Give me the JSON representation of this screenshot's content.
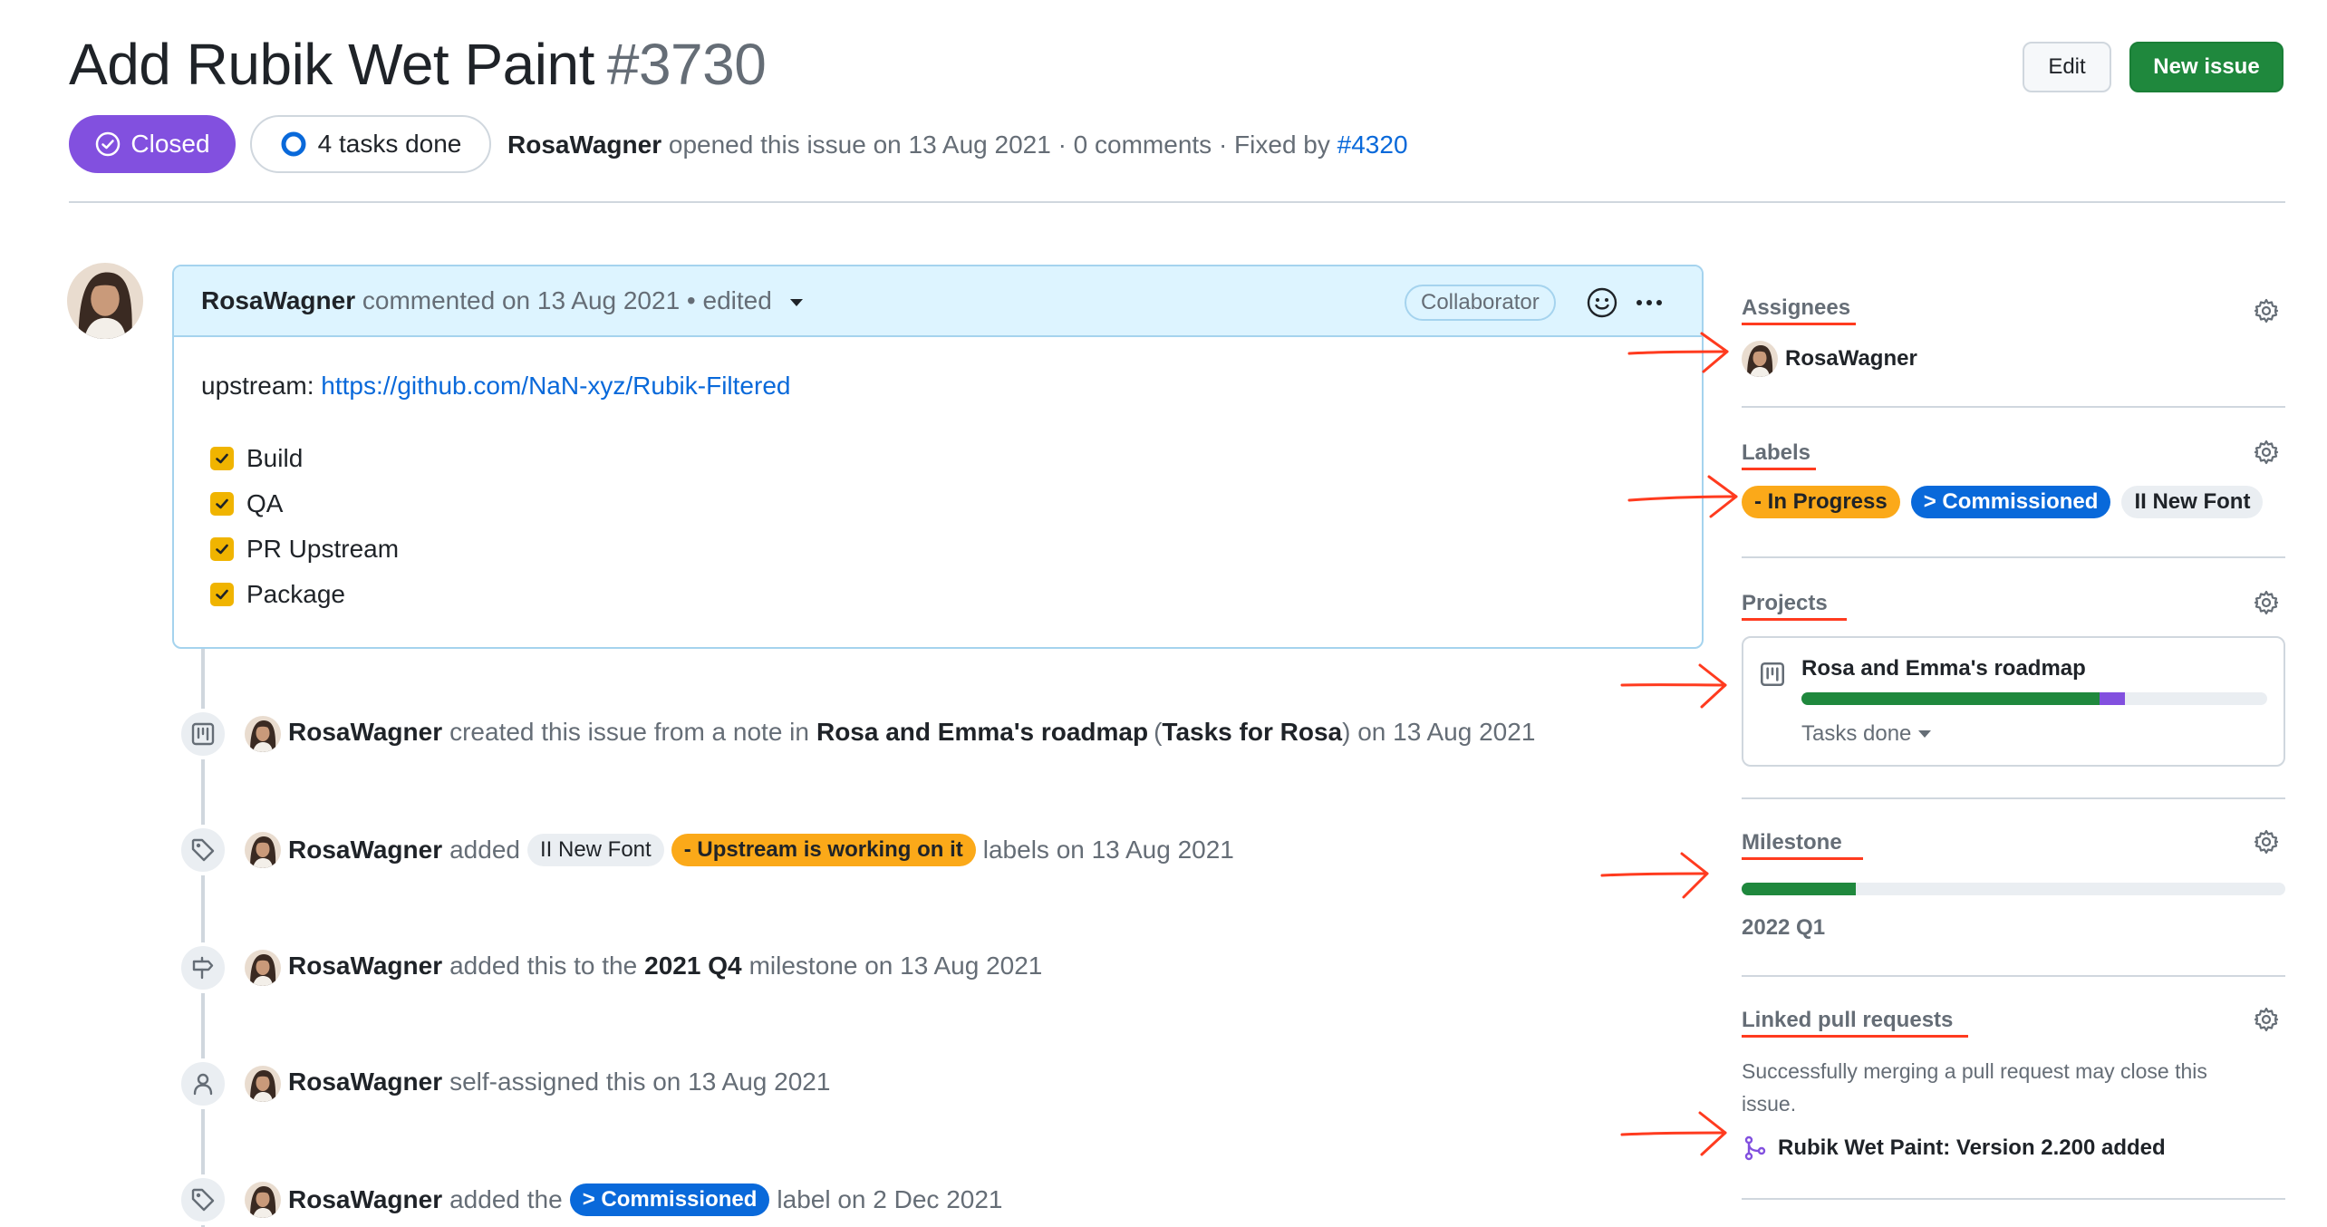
{
  "header": {
    "title": "Add Rubik Wet Paint",
    "number": "#3730",
    "edit_label": "Edit",
    "new_issue_label": "New issue",
    "state_label": "Closed",
    "tasks_label": "4 tasks done",
    "author": "RosaWagner",
    "meta_text": "opened this issue on 13 Aug 2021 · 0 comments · Fixed by",
    "fixed_by": "#4320"
  },
  "comment": {
    "author": "RosaWagner",
    "meta": "commented on 13 Aug 2021 • edited",
    "role_badge": "Collaborator",
    "upstream_label": "upstream:",
    "upstream_link": "https://github.com/NaN-xyz/Rubik-Filtered",
    "tasks": [
      {
        "label": "Build",
        "checked": true
      },
      {
        "label": "QA",
        "checked": true
      },
      {
        "label": "PR Upstream",
        "checked": true
      },
      {
        "label": "Package",
        "checked": true
      }
    ]
  },
  "timeline": {
    "event1": {
      "author": "RosaWagner",
      "t1": "created this issue from a note in",
      "project": "Rosa and Emma's roadmap",
      "t2": "(",
      "column": "Tasks for Rosa",
      "t3": ") on 13 Aug 2021"
    },
    "event2": {
      "author": "RosaWagner",
      "t1": "added",
      "label1": "II New Font",
      "label2": "- Upstream is working on it",
      "t2": "labels on 13 Aug 2021"
    },
    "event3": {
      "author": "RosaWagner",
      "t1": "added this to the",
      "milestone": "2021 Q4",
      "t2": "milestone on 13 Aug 2021"
    },
    "event4": {
      "author": "RosaWagner",
      "t1": "self-assigned this on 13 Aug 2021"
    },
    "event5": {
      "author": "RosaWagner",
      "t1": "added the",
      "label": "> Commissioned",
      "t2": "label on 2 Dec 2021"
    }
  },
  "sidebar": {
    "assignees": {
      "heading": "Assignees",
      "user": "RosaWagner"
    },
    "labels": {
      "heading": "Labels",
      "items": [
        "- In Progress",
        "> Commissioned",
        "II New Font"
      ]
    },
    "projects": {
      "heading": "Projects",
      "name": "Rosa and Emma's roadmap",
      "status": "Tasks done",
      "progress_done": 0.64,
      "progress_in_progress": 0.055
    },
    "milestone": {
      "heading": "Milestone",
      "name": "2022 Q1",
      "progress": 0.21
    },
    "linked_prs": {
      "heading": "Linked pull requests",
      "hint_line1": "Successfully merging a pull request may close this",
      "hint_line2": "issue.",
      "pr_title": "Rubik Wet Paint: Version 2.200 added"
    }
  },
  "colors": {
    "closed": "#8250df",
    "link": "#0969da",
    "green": "#1f883d",
    "label_orange": "#fba919",
    "label_blue": "#0969da",
    "annotation_red": "#ff3b1f"
  }
}
